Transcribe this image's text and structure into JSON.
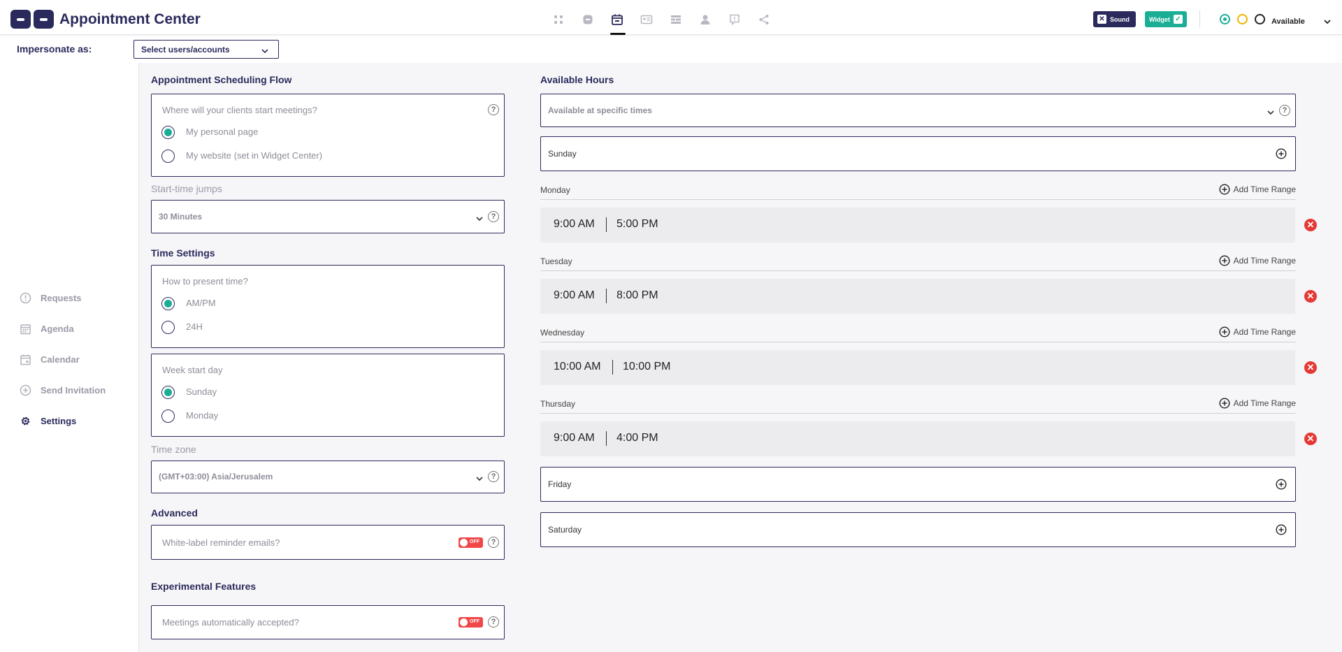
{
  "header": {
    "title": "Appointment Center",
    "nav_icons": [
      "apps-icon",
      "chat-icon",
      "calendar-icon",
      "id-card-icon",
      "list-icon",
      "user-icon",
      "message-icon",
      "share-icon"
    ],
    "active_nav": "calendar-icon",
    "sound_label": "Sound",
    "widget_label": "Widget",
    "status_label": "Available"
  },
  "impersonate": {
    "label": "Impersonate as:",
    "select_value": "Select users/accounts"
  },
  "sidebar": {
    "items": [
      {
        "label": "Requests",
        "icon": "alert-circle-icon"
      },
      {
        "label": "Agenda",
        "icon": "agenda-icon"
      },
      {
        "label": "Calendar",
        "icon": "calendar-icon"
      },
      {
        "label": "Send Invitation",
        "icon": "plus-circle-icon"
      },
      {
        "label": "Settings",
        "icon": "gear-icon"
      }
    ],
    "active": "Settings"
  },
  "settings": {
    "flow_title": "Appointment Scheduling Flow",
    "flow_question": "Where will your clients start meetings?",
    "flow_options": [
      "My personal page",
      "My website (set in Widget Center)"
    ],
    "flow_selected": "My personal page",
    "jumps_title": "Start-time jumps",
    "jumps_value": "30 Minutes",
    "time_settings_title": "Time Settings",
    "present_question": "How to present time?",
    "present_options": [
      "AM/PM",
      "24H"
    ],
    "present_selected": "AM/PM",
    "week_question": "Week start day",
    "week_options": [
      "Sunday",
      "Monday"
    ],
    "week_selected": "Sunday",
    "timezone_title": "Time zone",
    "timezone_value": "(GMT+03:00) Asia/Jerusalem",
    "advanced_title": "Advanced",
    "whitelabel_question": "White-label reminder emails?",
    "whitelabel_toggle": "OFF",
    "experimental_title": "Experimental Features",
    "auto_accept_question": "Meetings automatically accepted?",
    "auto_accept_toggle": "OFF"
  },
  "hours": {
    "title": "Available Hours",
    "mode_value": "Available at specific times",
    "add_label": "Add Time Range",
    "days": [
      {
        "name": "Sunday",
        "ranges": []
      },
      {
        "name": "Monday",
        "ranges": [
          {
            "from": "9:00 AM",
            "to": "5:00 PM"
          }
        ]
      },
      {
        "name": "Tuesday",
        "ranges": [
          {
            "from": "9:00 AM",
            "to": "8:00 PM"
          }
        ]
      },
      {
        "name": "Wednesday",
        "ranges": [
          {
            "from": "10:00 AM",
            "to": "10:00 PM"
          }
        ]
      },
      {
        "name": "Thursday",
        "ranges": [
          {
            "from": "9:00 AM",
            "to": "4:00 PM"
          }
        ]
      },
      {
        "name": "Friday",
        "ranges": []
      },
      {
        "name": "Saturday",
        "ranges": []
      }
    ]
  },
  "colors": {
    "brand": "#2b2a5c",
    "accent": "#1aae95",
    "danger": "#e53935"
  }
}
